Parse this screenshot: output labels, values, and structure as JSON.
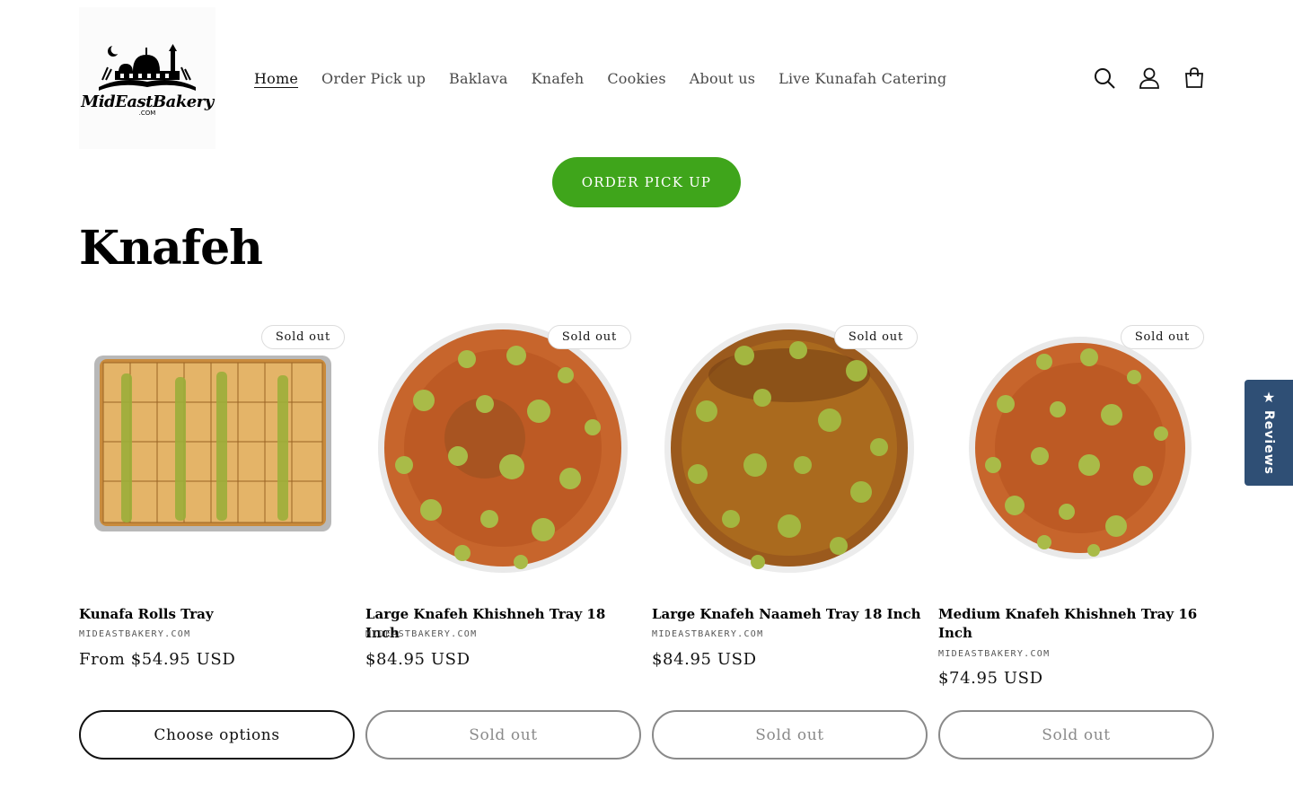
{
  "header": {
    "logo": {
      "brand": "MidEastBakery",
      "domain": ".COM"
    },
    "nav": [
      {
        "label": "Home",
        "active": true
      },
      {
        "label": "Order Pick up",
        "active": false
      },
      {
        "label": "Baklava",
        "active": false
      },
      {
        "label": "Knafeh",
        "active": false
      },
      {
        "label": "Cookies",
        "active": false
      },
      {
        "label": "About us",
        "active": false
      },
      {
        "label": "Live Kunafah Catering",
        "active": false
      }
    ],
    "icons": [
      "search-icon",
      "account-icon",
      "cart-icon"
    ]
  },
  "banner": {
    "button_label": "ORDER PICK UP",
    "button_color": "#3fa51b"
  },
  "collection": {
    "title": "Knafeh",
    "products": [
      {
        "title": "Kunafa Rolls Tray",
        "vendor": "MIDEASTBAKERY.COM",
        "price": "From $54.95 USD",
        "badge": "Sold out",
        "button": "Choose options",
        "button_enabled": true,
        "image": "tray-of-rolls"
      },
      {
        "title": "Large Knafeh Khishneh Tray 18 Inch",
        "vendor": "MIDEASTBAKERY.COM",
        "price": "$84.95 USD",
        "badge": "Sold out",
        "button": "Sold out",
        "button_enabled": false,
        "image": "round-knafeh-tray"
      },
      {
        "title": "Large Knafeh Naameh Tray 18 Inch",
        "vendor": "MIDEASTBAKERY.COM",
        "price": "$84.95 USD",
        "badge": "Sold out",
        "button": "Sold out",
        "button_enabled": false,
        "image": "round-knafeh-tray-syrup"
      },
      {
        "title": "Medium Knafeh Khishneh Tray 16 Inch",
        "vendor": "MIDEASTBAKERY.COM",
        "price": "$74.95 USD",
        "badge": "Sold out",
        "button": "Sold out",
        "button_enabled": false,
        "image": "round-knafeh-tray"
      }
    ]
  },
  "reviews_tab": {
    "label": "Reviews",
    "icon": "star-icon",
    "color": "#2f4f75"
  }
}
